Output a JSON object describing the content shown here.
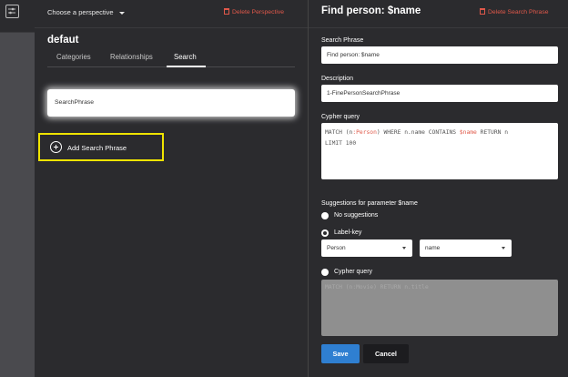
{
  "perspective": {
    "selector_label": "Choose a perspective",
    "delete_label": "Delete Perspective",
    "name": "defaut",
    "tabs": [
      {
        "label": "Categories",
        "active": false
      },
      {
        "label": "Relationships",
        "active": false
      },
      {
        "label": "Search",
        "active": true
      }
    ],
    "search_phrases": [
      "SearchPhrase"
    ],
    "add_phrase_label": "Add Search Phrase"
  },
  "editor": {
    "title": "Find person: $name",
    "delete_label": "Delete Search Phrase",
    "search_phrase": {
      "label": "Search Phrase",
      "value": "Find person: $name"
    },
    "description": {
      "label": "Description",
      "value": "1-FinePersonSearchPhrase"
    },
    "cypher": {
      "label": "Cypher query",
      "line1_pre": "MATCH (n",
      "line1_label": ":Person",
      "line1_mid": ") WHERE n.name CONTAINS ",
      "line1_param": "$name",
      "line1_post": "  RETURN n",
      "line2": "LIMIT 100"
    },
    "suggestions": {
      "label": "Suggestions for parameter $name",
      "options": [
        {
          "label": "No suggestions",
          "selected": false
        },
        {
          "label": "Label-key",
          "selected": true
        },
        {
          "label": "Cypher query",
          "selected": false
        }
      ],
      "label_select": "Person",
      "key_select": "name",
      "cypher_placeholder": "MATCH (n:Movie) RETURN n.title"
    },
    "save_label": "Save",
    "cancel_label": "Cancel"
  },
  "colors": {
    "accent_blue": "#2f7fd1",
    "delete_red": "#e0584a",
    "highlight_yellow": "#f0e400",
    "background": "#2b2b2e"
  }
}
